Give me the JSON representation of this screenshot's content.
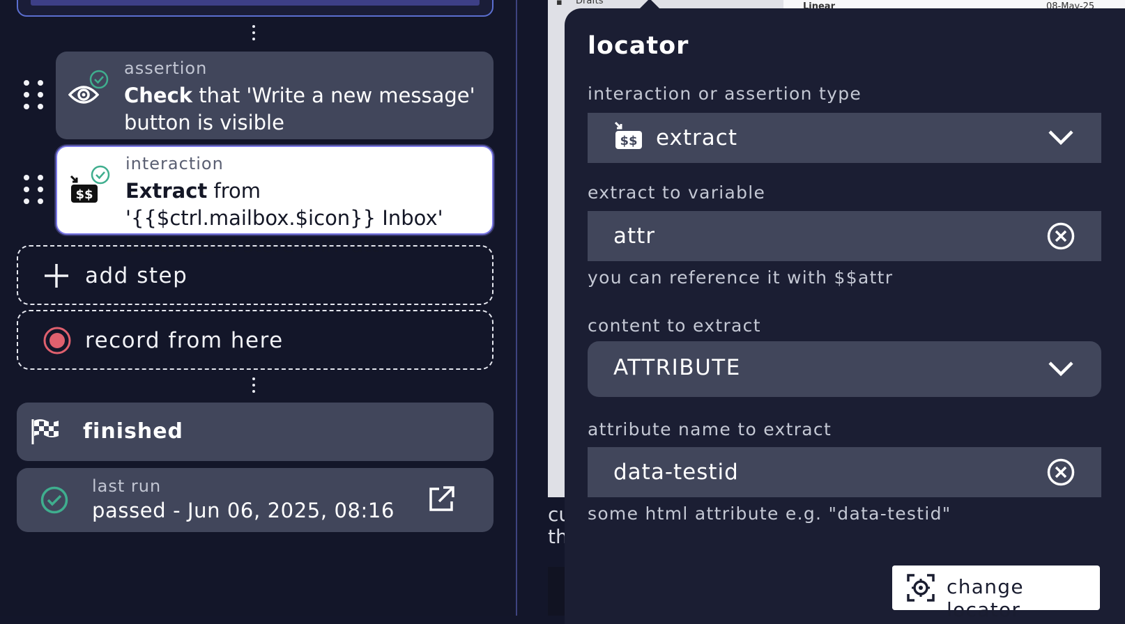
{
  "steps_panel": {
    "steps": [
      {
        "kind": "assertion",
        "verb": "Check",
        "text": " that 'Write a new message' button is visible",
        "icon": "eye-icon",
        "status": "passed"
      },
      {
        "kind": "interaction",
        "verb": "Extract",
        "text": " from '{{$ctrl.mailbox.$icon}} Inbox' button and store it in 'attr'",
        "icon": "extract-dollar-icon",
        "status": "passed",
        "selected": true
      }
    ],
    "add_step_label": "add step",
    "record_label": "record from here",
    "finished_label": "finished",
    "last_run": {
      "label": "last run",
      "value": "passed - Jun 06, 2025, 08:16"
    }
  },
  "preview": {
    "items": [
      "Drafts",
      "Linear",
      "08-May-25"
    ],
    "behind_text": [
      "cu",
      "th"
    ]
  },
  "locator_panel": {
    "title": "locator",
    "type_label": "interaction or assertion type",
    "type_value": "extract",
    "variable_label": "extract to variable",
    "variable_value": "attr",
    "variable_hint": "you can reference it with $$attr",
    "content_label": "content to extract",
    "content_value": "ATTRIBUTE",
    "attr_label": "attribute name to extract",
    "attr_value": "data-testid",
    "attr_hint": "some html attribute e.g. \"data-testid\"",
    "change_locator_label": "change locator"
  },
  "colors": {
    "accent": "#7a78e6",
    "success": "#3fae8e",
    "record": "#e0606e",
    "panel": "#1b1e33",
    "field": "#41465b"
  }
}
